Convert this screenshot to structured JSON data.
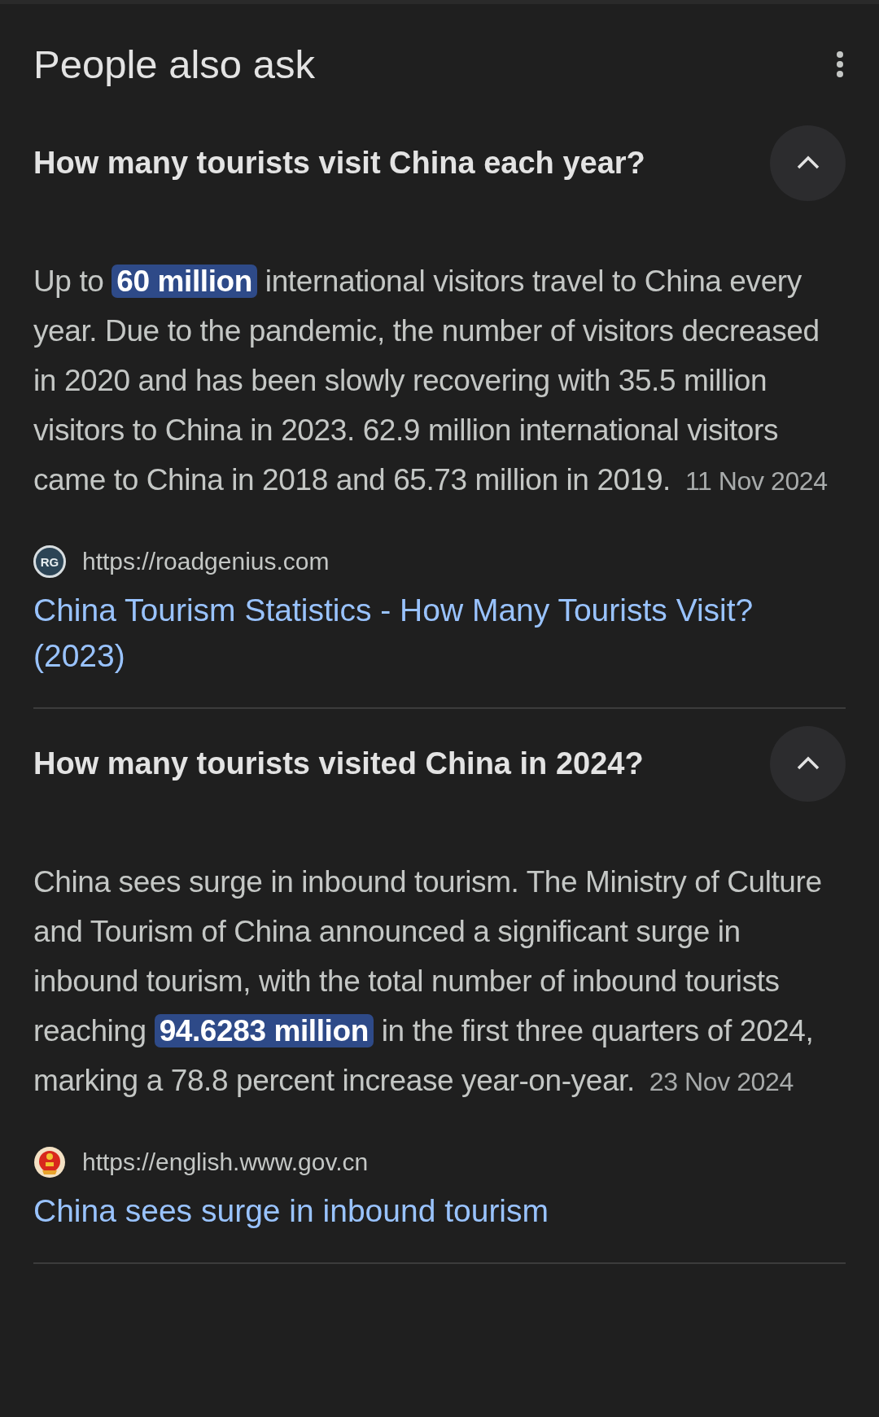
{
  "header": {
    "title": "People also ask"
  },
  "questions": [
    {
      "question": "How many tourists visit China each year?",
      "expanded": true,
      "answer": "Up to **60 million** international visitors travel to China every year. Due to the pandemic, the number of visitors decreased in 2020 and has been slowly recovering with 35.5 million visitors to China in 2023. 62.9 million international visitors came to China in 2018 and 65.73 million in 2019.",
      "date": "11 Nov 2024",
      "source": {
        "favicon_text": "RG",
        "url": "https://roadgenius.com",
        "title": "China Tourism Statistics - How Many Tourists Visit? (2023)"
      }
    },
    {
      "question": "How many tourists visited China in 2024?",
      "expanded": true,
      "answer": "China sees surge in inbound tourism. The Ministry of Culture and Tourism of China announced a significant surge in inbound tourism, with the total number of inbound tourists reaching **94.6283 million** in the first three quarters of 2024, marking a 78.8 percent increase year-on-year.",
      "date": "23 Nov 2024",
      "source": {
        "url": "https://english.www.gov.cn",
        "title": "China sees surge in inbound tourism"
      }
    }
  ]
}
